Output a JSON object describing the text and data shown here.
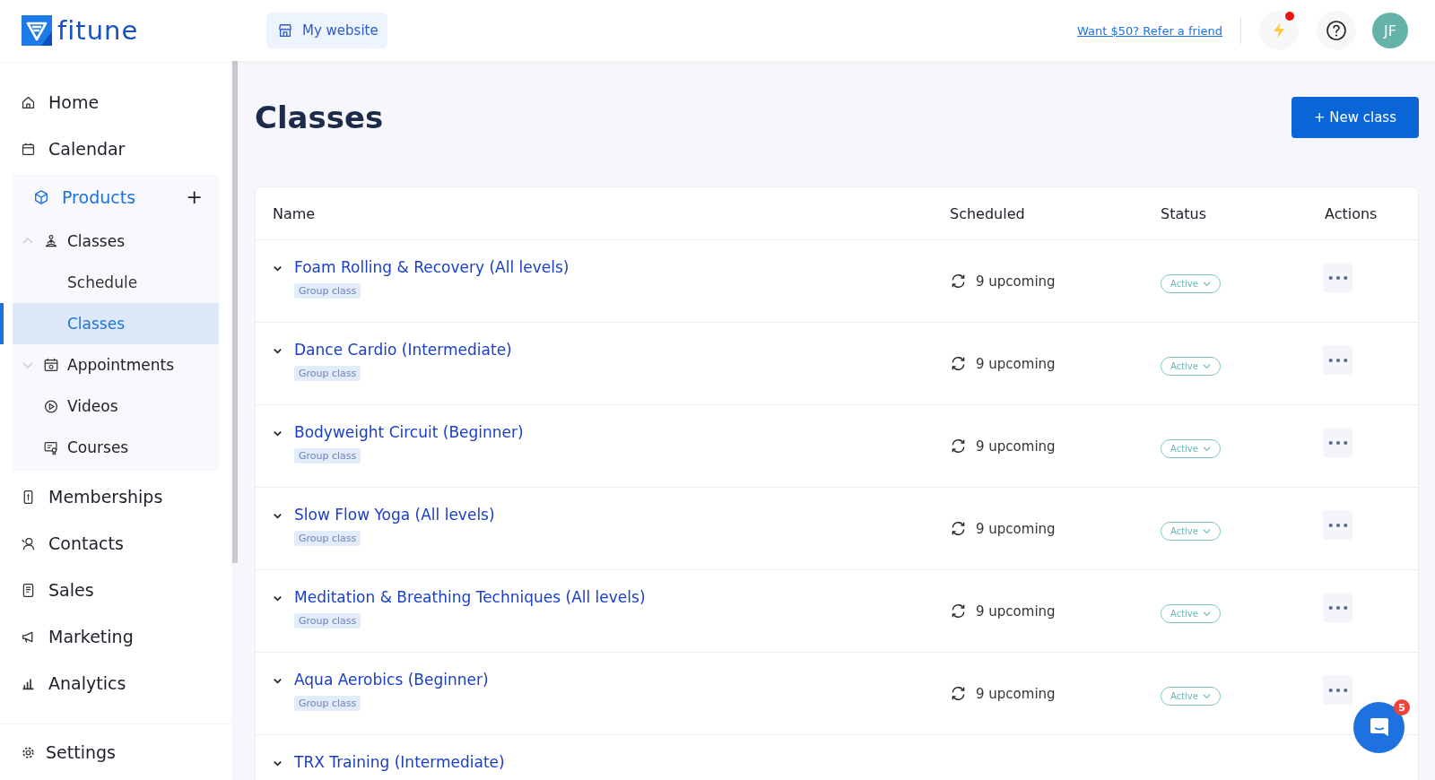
{
  "header": {
    "logo": "fitune",
    "website_button": "My website",
    "refer_link": "Want $50? Refer a friend",
    "notification_dot": true,
    "avatar": "JF"
  },
  "sidebar": {
    "items": [
      {
        "label": "Home",
        "selected": false
      },
      {
        "label": "Calendar",
        "selected": false
      },
      {
        "label": "Products",
        "selected": true,
        "add": "+",
        "children": [
          {
            "label": "Classes",
            "selected": false,
            "expanded": true,
            "children": [
              {
                "label": "Schedule",
                "selected": false
              },
              {
                "label": "Classes",
                "selected": true
              }
            ]
          },
          {
            "label": "Appointments",
            "selected": false,
            "expanded": false
          },
          {
            "label": "Videos",
            "selected": false
          },
          {
            "label": "Courses",
            "selected": false
          }
        ]
      },
      {
        "label": "Memberships",
        "selected": false
      },
      {
        "label": "Contacts",
        "selected": false
      },
      {
        "label": "Sales",
        "selected": false
      },
      {
        "label": "Marketing",
        "selected": false
      },
      {
        "label": "Analytics",
        "selected": false
      }
    ],
    "footer": "Settings"
  },
  "page": {
    "title": "Classes",
    "new_button": "+ New class"
  },
  "table": {
    "columns": [
      "Name",
      "Scheduled",
      "Status",
      "Actions"
    ],
    "rows": [
      {
        "name": "Foam Rolling & Recovery (All levels)",
        "tag": "Group class",
        "scheduled": "9 upcoming",
        "status": "Active",
        "expanded": false
      },
      {
        "name": "Dance Cardio (Intermediate)",
        "tag": "Group class",
        "scheduled": "9 upcoming",
        "status": "Active",
        "expanded": false
      },
      {
        "name": "Bodyweight Circuit (Beginner)",
        "tag": "Group class",
        "scheduled": "9 upcoming",
        "status": "Active",
        "expanded": false
      },
      {
        "name": "Slow Flow Yoga (All levels)",
        "tag": "Group class",
        "scheduled": "9 upcoming",
        "status": "Active",
        "expanded": false
      },
      {
        "name": "Meditation & Breathing Techniques (All levels)",
        "tag": "Group class",
        "scheduled": "9 upcoming",
        "status": "Active",
        "expanded": false
      },
      {
        "name": "Aqua Aerobics (Beginner)",
        "tag": "Group class",
        "scheduled": "9 upcoming",
        "status": "Active",
        "expanded": false
      },
      {
        "name": "TRX Training (Intermediate)",
        "expanded": false
      }
    ]
  },
  "chat": {
    "badge": "5"
  }
}
